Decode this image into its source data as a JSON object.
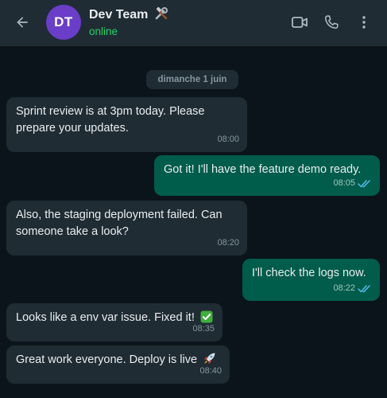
{
  "header": {
    "avatar_initials": "DT",
    "chat_name": "Dev Team",
    "chat_name_emoji": "hammer-and-wrench-emoji",
    "status": "online",
    "icons": [
      "arrow-left-icon",
      "video-call-icon",
      "voice-call-icon",
      "more-vert-icon"
    ]
  },
  "date_separator": "dimanche 1 juin",
  "messages": [
    {
      "direction": "in",
      "lines": [
        "Sprint review is at 3pm today. Please",
        "prepare your updates."
      ],
      "time": "08:00"
    },
    {
      "direction": "out",
      "lines": [
        "Got it! I'll have the feature demo ready."
      ],
      "time": "08:05",
      "status": "read"
    },
    {
      "direction": "in",
      "lines": [
        "Also, the staging deployment failed. Can",
        "someone take a look?"
      ],
      "time": "08:20"
    },
    {
      "direction": "out",
      "lines": [
        "I'll check the logs now."
      ],
      "time": "08:22",
      "status": "read"
    },
    {
      "direction": "in",
      "lines": [
        "Looks like a env var issue. Fixed it!"
      ],
      "emoji": "check-mark-button-emoji",
      "time": "08:35"
    },
    {
      "direction": "in",
      "lines": [
        "Great work everyone. Deploy is live"
      ],
      "emoji": "rocket-emoji",
      "time": "08:40"
    }
  ],
  "colors": {
    "background": "#0b141a",
    "header": "#1f2c34",
    "incoming_bubble": "#1f2c34",
    "outgoing_bubble": "#005c4b",
    "avatar": "#6a3ec8",
    "online": "#25d366",
    "read_ticks": "#53bdeb"
  }
}
